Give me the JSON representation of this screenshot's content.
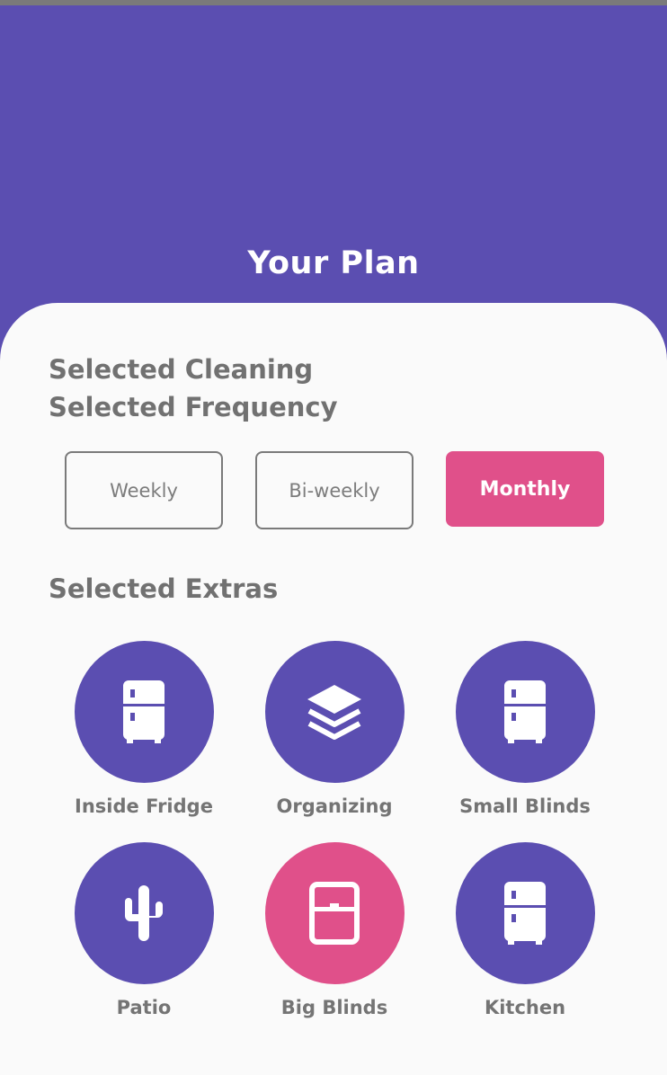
{
  "header": {
    "title": "Your Plan"
  },
  "sections": {
    "cleaning_title": "Selected Cleaning",
    "frequency_title": "Selected Frequency",
    "extras_title": "Selected Extras"
  },
  "frequency": {
    "options": [
      "Weekly",
      "Bi-weekly",
      "Monthly"
    ],
    "selected": "Monthly"
  },
  "extras": [
    {
      "label": "Inside Fridge",
      "icon": "fridge-icon",
      "selected": false
    },
    {
      "label": "Organizing",
      "icon": "layers-icon",
      "selected": false
    },
    {
      "label": "Small Blinds",
      "icon": "fridge-icon",
      "selected": false
    },
    {
      "label": "Patio",
      "icon": "cactus-icon",
      "selected": false
    },
    {
      "label": "Big Blinds",
      "icon": "window-blind-icon",
      "selected": true
    },
    {
      "label": "Kitchen",
      "icon": "fridge-icon",
      "selected": false
    }
  ],
  "colors": {
    "primary": "#5b4eb1",
    "accent": "#e0508a",
    "background": "#fafafa",
    "text": "#717171"
  }
}
